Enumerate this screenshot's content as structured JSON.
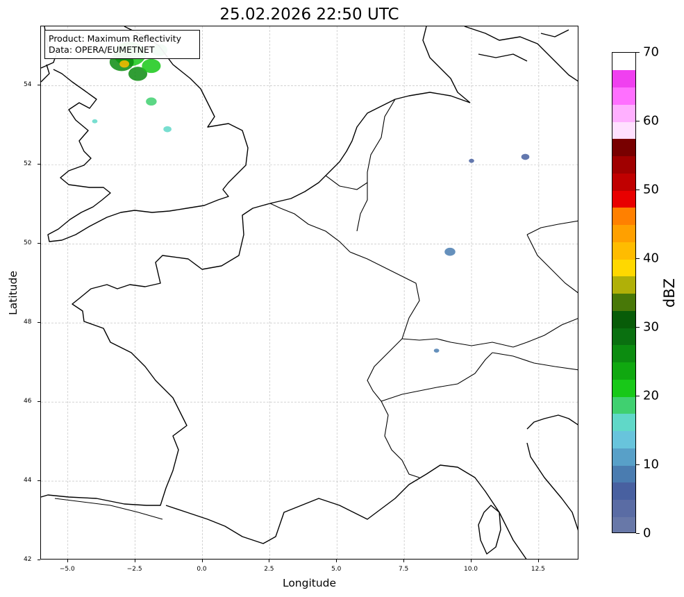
{
  "title": "25.02.2026 22:50 UTC",
  "info": {
    "line1": "Product: Maximum Reflectivity",
    "line2": "Data: OPERA/EUMETNET"
  },
  "axes": {
    "xlabel": "Longitude",
    "ylabel": "Latitude",
    "xlim": [
      -6,
      14
    ],
    "ylim": [
      42,
      55.5
    ],
    "xticks": [
      {
        "value": -5.0,
        "label": "−5.0"
      },
      {
        "value": -2.5,
        "label": "−2.5"
      },
      {
        "value": 0.0,
        "label": "0.0"
      },
      {
        "value": 2.5,
        "label": "2.5"
      },
      {
        "value": 5.0,
        "label": "5.0"
      },
      {
        "value": 7.5,
        "label": "7.5"
      },
      {
        "value": 10.0,
        "label": "10.0"
      },
      {
        "value": 12.5,
        "label": "12.5"
      }
    ],
    "yticks": [
      {
        "value": 42,
        "label": "42"
      },
      {
        "value": 44,
        "label": "44"
      },
      {
        "value": 46,
        "label": "46"
      },
      {
        "value": 48,
        "label": "48"
      },
      {
        "value": 50,
        "label": "50"
      },
      {
        "value": 52,
        "label": "52"
      },
      {
        "value": 54,
        "label": "54"
      }
    ],
    "grid": true
  },
  "colorbar": {
    "label": "dBZ",
    "min": 0,
    "max": 70,
    "ticks": [
      {
        "value": 0,
        "label": "0"
      },
      {
        "value": 10,
        "label": "10"
      },
      {
        "value": 20,
        "label": "20"
      },
      {
        "value": 30,
        "label": "30"
      },
      {
        "value": 40,
        "label": "40"
      },
      {
        "value": 50,
        "label": "50"
      },
      {
        "value": 60,
        "label": "60"
      },
      {
        "value": 70,
        "label": "70"
      }
    ],
    "colors": [
      "#6878a8",
      "#5a6ca4",
      "#4860a0",
      "#4a7cb0",
      "#58a0c8",
      "#68c4dc",
      "#60d8c8",
      "#40d070",
      "#18c818",
      "#10a810",
      "#0c8c10",
      "#0a7010",
      "#085c08",
      "#487808",
      "#b0b008",
      "#ffd800",
      "#ffbc00",
      "#ffa000",
      "#ff8000",
      "#e80000",
      "#c00000",
      "#a00000",
      "#780000",
      "#ffe0ff",
      "#ffb0ff",
      "#ff70ff",
      "#f040f0"
    ],
    "segment_bounds": [
      0,
      2.5,
      5,
      7.5,
      10,
      12.5,
      15,
      17.5,
      20,
      22.5,
      25,
      27.5,
      30,
      32.5,
      35,
      37.5,
      40,
      42.5,
      45,
      47.5,
      50,
      52.5,
      55,
      57.5,
      60,
      62.5,
      65,
      67.5,
      70
    ]
  },
  "map": {
    "coastline_color": "#000000",
    "echo_colors": {
      "weak": "#4a7cb0",
      "light": "#60d8c8",
      "moderate": "#18c818",
      "strong": "#0c8c10",
      "heavy": "#ffbc00"
    },
    "echoes": [
      {
        "lon": -2.7,
        "lat": 54.8,
        "dbz": 20,
        "r": 0.6
      },
      {
        "lon": -3.0,
        "lat": 54.6,
        "dbz": 25,
        "r": 0.45
      },
      {
        "lon": -2.9,
        "lat": 54.55,
        "dbz": 40,
        "r": 0.18
      },
      {
        "lon": -2.4,
        "lat": 54.3,
        "dbz": 25,
        "r": 0.35
      },
      {
        "lon": -1.9,
        "lat": 54.5,
        "dbz": 22,
        "r": 0.35
      },
      {
        "lon": -1.6,
        "lat": 54.9,
        "dbz": 18,
        "r": 0.3
      },
      {
        "lon": -1.9,
        "lat": 53.6,
        "dbz": 18,
        "r": 0.2
      },
      {
        "lon": -1.3,
        "lat": 52.9,
        "dbz": 15,
        "r": 0.15
      },
      {
        "lon": -4.0,
        "lat": 53.1,
        "dbz": 15,
        "r": 0.1
      },
      {
        "lon": 9.2,
        "lat": 49.8,
        "dbz": 8,
        "r": 0.2
      },
      {
        "lon": 8.7,
        "lat": 47.3,
        "dbz": 8,
        "r": 0.1
      },
      {
        "lon": 10.0,
        "lat": 52.1,
        "dbz": 6,
        "r": 0.1
      },
      {
        "lon": 12.0,
        "lat": 52.2,
        "dbz": 5,
        "r": 0.15
      }
    ]
  }
}
